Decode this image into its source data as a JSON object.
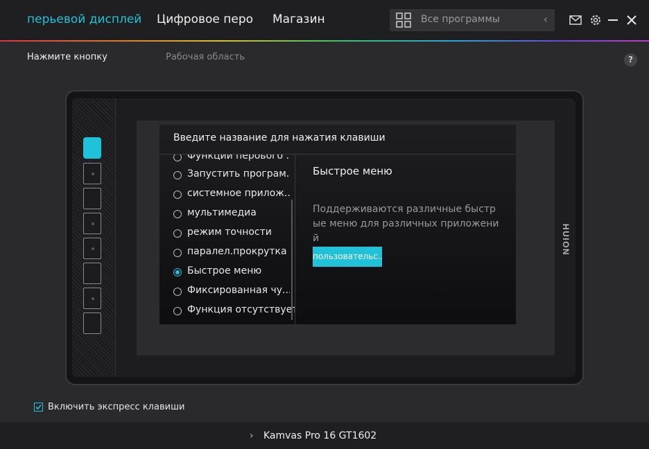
{
  "nav": {
    "tabs": [
      {
        "label": "перьевой дисплей",
        "active": true
      },
      {
        "label": "Цифровое перо",
        "active": false
      },
      {
        "label": "Магазин",
        "active": false
      }
    ]
  },
  "search": {
    "placeholder": "Все программы",
    "back_icon": "chevron-left-icon"
  },
  "window_controls": [
    "mail-icon",
    "gear-icon",
    "minimize-icon",
    "close-icon"
  ],
  "subnav": {
    "press_button": "Нажмите кнопку",
    "work_area": "Рабочая область",
    "help": "?"
  },
  "tablet": {
    "brand": "HUION",
    "express_keys_count": 8,
    "active_key_index": 0
  },
  "dialog": {
    "title": "Введите название для нажатия клавиши",
    "options": [
      {
        "label": "Функции пероього ...",
        "selected": false
      },
      {
        "label": "Запустить програм...",
        "selected": false
      },
      {
        "label": "системное прилож...",
        "selected": false
      },
      {
        "label": "мультимедиа",
        "selected": false
      },
      {
        "label": "режим точности",
        "selected": false
      },
      {
        "label": "паралел.прокрутка",
        "selected": false
      },
      {
        "label": "Быстрое меню",
        "selected": true
      },
      {
        "label": "Фиксированная чу...",
        "selected": false
      },
      {
        "label": "Функция отсутствует",
        "selected": false
      }
    ],
    "detail": {
      "title": "Быстрое меню",
      "description": "Поддерживаются различные быстрые меню для различных приложений",
      "button": "пользовательс..."
    }
  },
  "express_keys_toggle": {
    "label": "Включить экспресс клавиши",
    "checked": true
  },
  "footer": {
    "device": "Kamvas Pro 16 GT1602"
  },
  "colors": {
    "accent": "#1fc2d8",
    "background": "#2a2a2c",
    "topbar": "#1f1f21"
  }
}
